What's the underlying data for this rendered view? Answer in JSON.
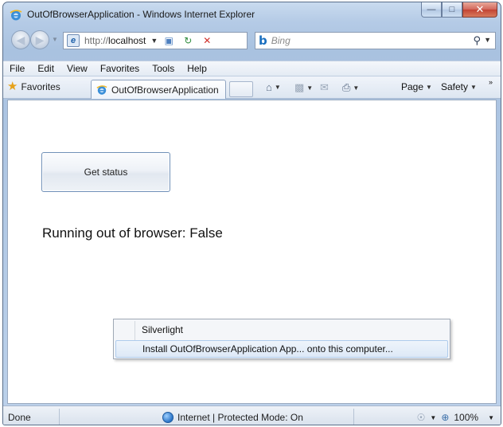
{
  "window": {
    "title": "OutOfBrowserApplication - Windows Internet Explorer",
    "caption_buttons": [
      "minimize-icon",
      "maximize-icon",
      "close-icon"
    ]
  },
  "address_bar": {
    "url_prefix": "http://",
    "url_host": "localhost"
  },
  "search": {
    "engine": "Bing",
    "placeholder": "Bing"
  },
  "menu": [
    "File",
    "Edit",
    "View",
    "Favorites",
    "Tools",
    "Help"
  ],
  "favorites_bar": {
    "favorites_label": "Favorites",
    "tab_title": "OutOfBrowserApplication",
    "page_label": "Page",
    "safety_label": "Safety"
  },
  "content": {
    "button_label": "Get status",
    "status_text": "Running out of browser: False"
  },
  "context_menu": {
    "items": [
      "Silverlight",
      "Install OutOfBrowserApplication App... onto this computer..."
    ],
    "highlighted_index": 1
  },
  "status_bar": {
    "left": "Done",
    "zone": "Internet | Protected Mode: On",
    "zoom": "100%"
  },
  "colors": {
    "chrome": "#b5cbe6",
    "close_button": "#c24333",
    "menu_highlight": "#dde9f7"
  }
}
